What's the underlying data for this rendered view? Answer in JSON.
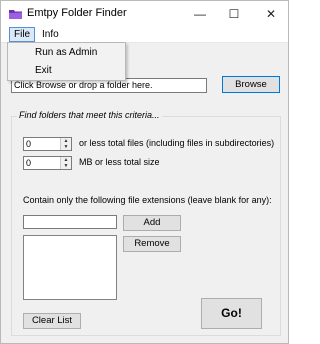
{
  "window": {
    "title": "Emtpy Folder Finder"
  },
  "titlebar_buttons": {
    "minimize": "—",
    "maximize": "☐",
    "close": "✕"
  },
  "menu": {
    "file": "File",
    "info": "Info",
    "file_items": [
      "Run as Admin",
      "Exit"
    ]
  },
  "path": {
    "value": "Click Browse or drop a folder here."
  },
  "browse_label": "Browse",
  "criteria": {
    "legend": "Find folders that meet this criteria...",
    "files_value": "0",
    "files_label": "or less total files (including files in subdirectories)",
    "size_value": "0",
    "size_label": "MB or less total size",
    "extensions_label": "Contain only the following file extensions (leave blank for any):",
    "extension_value": "",
    "extensions": []
  },
  "buttons": {
    "add": "Add",
    "remove": "Remove",
    "clear": "Clear List",
    "go": "Go!"
  },
  "icons": {
    "app": "purple-folder-icon",
    "spin_up": "up-arrow-icon",
    "spin_down": "down-arrow-icon"
  },
  "colors": {
    "accent": "#0078d7",
    "menu_highlight": "#dbe8f7",
    "app_icon": "#7b3fc4"
  }
}
